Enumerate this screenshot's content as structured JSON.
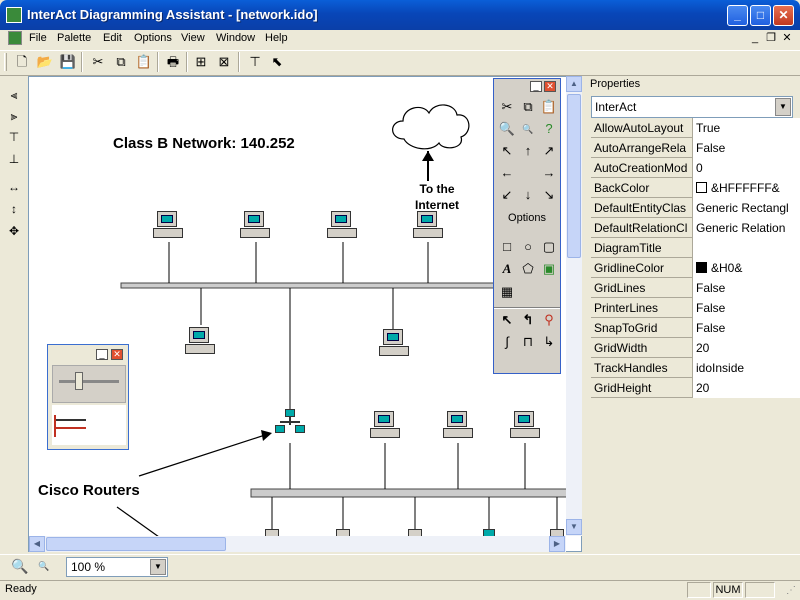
{
  "window": {
    "title": "InterAct Diagramming Assistant - [network.ido]"
  },
  "menu": [
    "File",
    "Palette",
    "Edit",
    "Options",
    "View",
    "Window",
    "Help"
  ],
  "toolbar": {
    "icons": [
      "new-icon",
      "open-icon",
      "save-icon",
      "cut-icon",
      "copy-icon",
      "paste-icon",
      "print-icon",
      "arrange-icon",
      "layout-icon",
      "tree-icon",
      "pointer-icon"
    ]
  },
  "canvas": {
    "network_title": "Class B Network: 140.252",
    "internet_label": "To the\nInternet",
    "routers_label": "Cisco Routers"
  },
  "palette": {
    "options_label": "Options"
  },
  "properties": {
    "title": "Properties",
    "selected_object": "InterAct",
    "rows": [
      {
        "name": "AllowAutoLayout",
        "value": "True"
      },
      {
        "name": "AutoArrangeRela",
        "value": "False"
      },
      {
        "name": "AutoCreationMod",
        "value": "0"
      },
      {
        "name": "BackColor",
        "value": "&HFFFFFF&",
        "swatch": "#ffffff"
      },
      {
        "name": "DefaultEntityClas",
        "value": "Generic Rectangl"
      },
      {
        "name": "DefaultRelationCl",
        "value": "Generic Relation"
      },
      {
        "name": "DiagramTitle",
        "value": ""
      },
      {
        "name": "GridlineColor",
        "value": "&H0&",
        "swatch": "#000000"
      },
      {
        "name": "GridLines",
        "value": "False"
      },
      {
        "name": "PrinterLines",
        "value": "False"
      },
      {
        "name": "SnapToGrid",
        "value": "False"
      },
      {
        "name": "GridWidth",
        "value": "20"
      },
      {
        "name": "TrackHandles",
        "value": "idoInside"
      },
      {
        "name": "GridHeight",
        "value": "20"
      }
    ]
  },
  "zoom": {
    "value": "100 %"
  },
  "status": {
    "text": "Ready",
    "num": "NUM"
  }
}
